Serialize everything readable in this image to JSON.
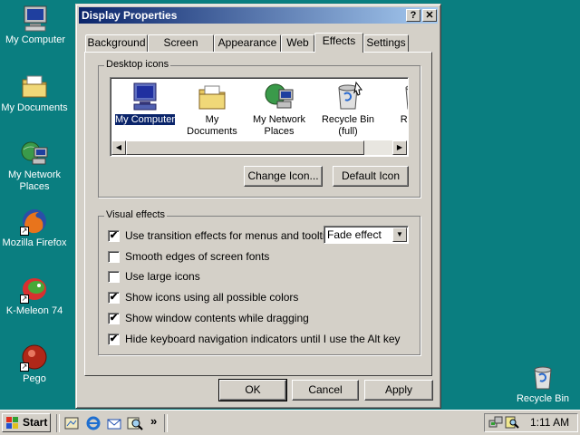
{
  "desktop": {
    "icons": [
      {
        "label": "My Computer",
        "icon": "my-computer-icon"
      },
      {
        "label": "My Documents",
        "icon": "my-documents-icon"
      },
      {
        "label": "My Network Places",
        "icon": "network-places-icon"
      },
      {
        "label": "Mozilla Firefox",
        "icon": "firefox-icon"
      },
      {
        "label": "K-Meleon 74",
        "icon": "k-meleon-icon"
      },
      {
        "label": "Pego",
        "icon": "pego-icon"
      }
    ],
    "recycle_bin": {
      "label": "Recycle Bin",
      "icon": "recycle-bin-icon"
    }
  },
  "window": {
    "title": "Display Properties",
    "help_glyph": "?",
    "close_glyph": "✕",
    "tabs": [
      {
        "label": "Background"
      },
      {
        "label": "Screen Saver"
      },
      {
        "label": "Appearance"
      },
      {
        "label": "Web"
      },
      {
        "label": "Effects"
      },
      {
        "label": "Settings"
      }
    ],
    "active_tab": "Effects",
    "desktop_icons": {
      "title": "Desktop icons",
      "items": [
        {
          "label": "My Computer",
          "selected": true
        },
        {
          "label": "My Documents"
        },
        {
          "label": "My Network Places"
        },
        {
          "label": "Recycle Bin (full)"
        },
        {
          "label": "Rec (e"
        }
      ],
      "change_icon_button": "Change Icon...",
      "default_icon_button": "Default Icon"
    },
    "visual_effects": {
      "title": "Visual effects",
      "options": [
        {
          "label": "Use transition effects for menus and tooltips",
          "checked": true
        },
        {
          "label": "Smooth edges of screen fonts",
          "checked": false
        },
        {
          "label": "Use large icons",
          "checked": false
        },
        {
          "label": "Show icons using all possible colors",
          "checked": true
        },
        {
          "label": "Show window contents while dragging",
          "checked": true
        },
        {
          "label": "Hide keyboard navigation indicators until I use the Alt key",
          "checked": true
        }
      ],
      "transition_effect_value": "Fade effect",
      "check_glyph": "✔"
    },
    "buttons": {
      "ok": "OK",
      "cancel": "Cancel",
      "apply": "Apply"
    }
  },
  "taskbar": {
    "start_label": "Start",
    "more_glyph": "»",
    "clock": "1:11 AM"
  }
}
